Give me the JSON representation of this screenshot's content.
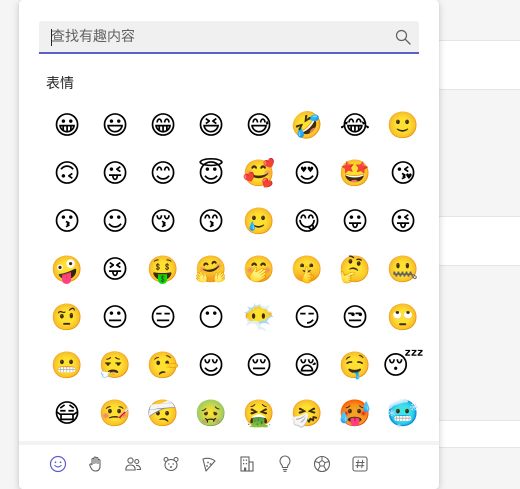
{
  "search": {
    "placeholder": "查找有趣内容"
  },
  "section": {
    "title": "表情"
  },
  "emojis": [
    "😀",
    "😃",
    "😁",
    "😆",
    "😅",
    "🤣",
    "😂",
    "🙂",
    "🙃",
    "😜",
    "😊",
    "😇",
    "🥰",
    "😍",
    "🤩",
    "😘",
    "😗",
    "☺",
    "😚",
    "😙",
    "🥲",
    "😋",
    "😛",
    "😜",
    "🤪",
    "😝",
    "🤑",
    "🤗",
    "🤭",
    "🤫",
    "🤔",
    "🤐",
    "🤨",
    "😐",
    "😑",
    "😶",
    "😶‍🌫️",
    "😏",
    "😒",
    "🙄",
    "😬",
    "😮‍💨",
    "🤥",
    "😌",
    "😔",
    "😪",
    "🤤",
    "😴",
    "😷",
    "🤒",
    "🤕",
    "🤢",
    "🤮",
    "🤧",
    "🥵",
    "🥶"
  ],
  "tabs": [
    {
      "icon": "smiley-icon",
      "active": true
    },
    {
      "icon": "hand-icon"
    },
    {
      "icon": "people-icon"
    },
    {
      "icon": "animal-icon"
    },
    {
      "icon": "food-icon"
    },
    {
      "icon": "building-icon"
    },
    {
      "icon": "lightbulb-icon"
    },
    {
      "icon": "soccer-ball-icon"
    },
    {
      "icon": "symbols-icon"
    }
  ],
  "colors": {
    "accent": "#5b5fc7",
    "icon": "#616161"
  }
}
